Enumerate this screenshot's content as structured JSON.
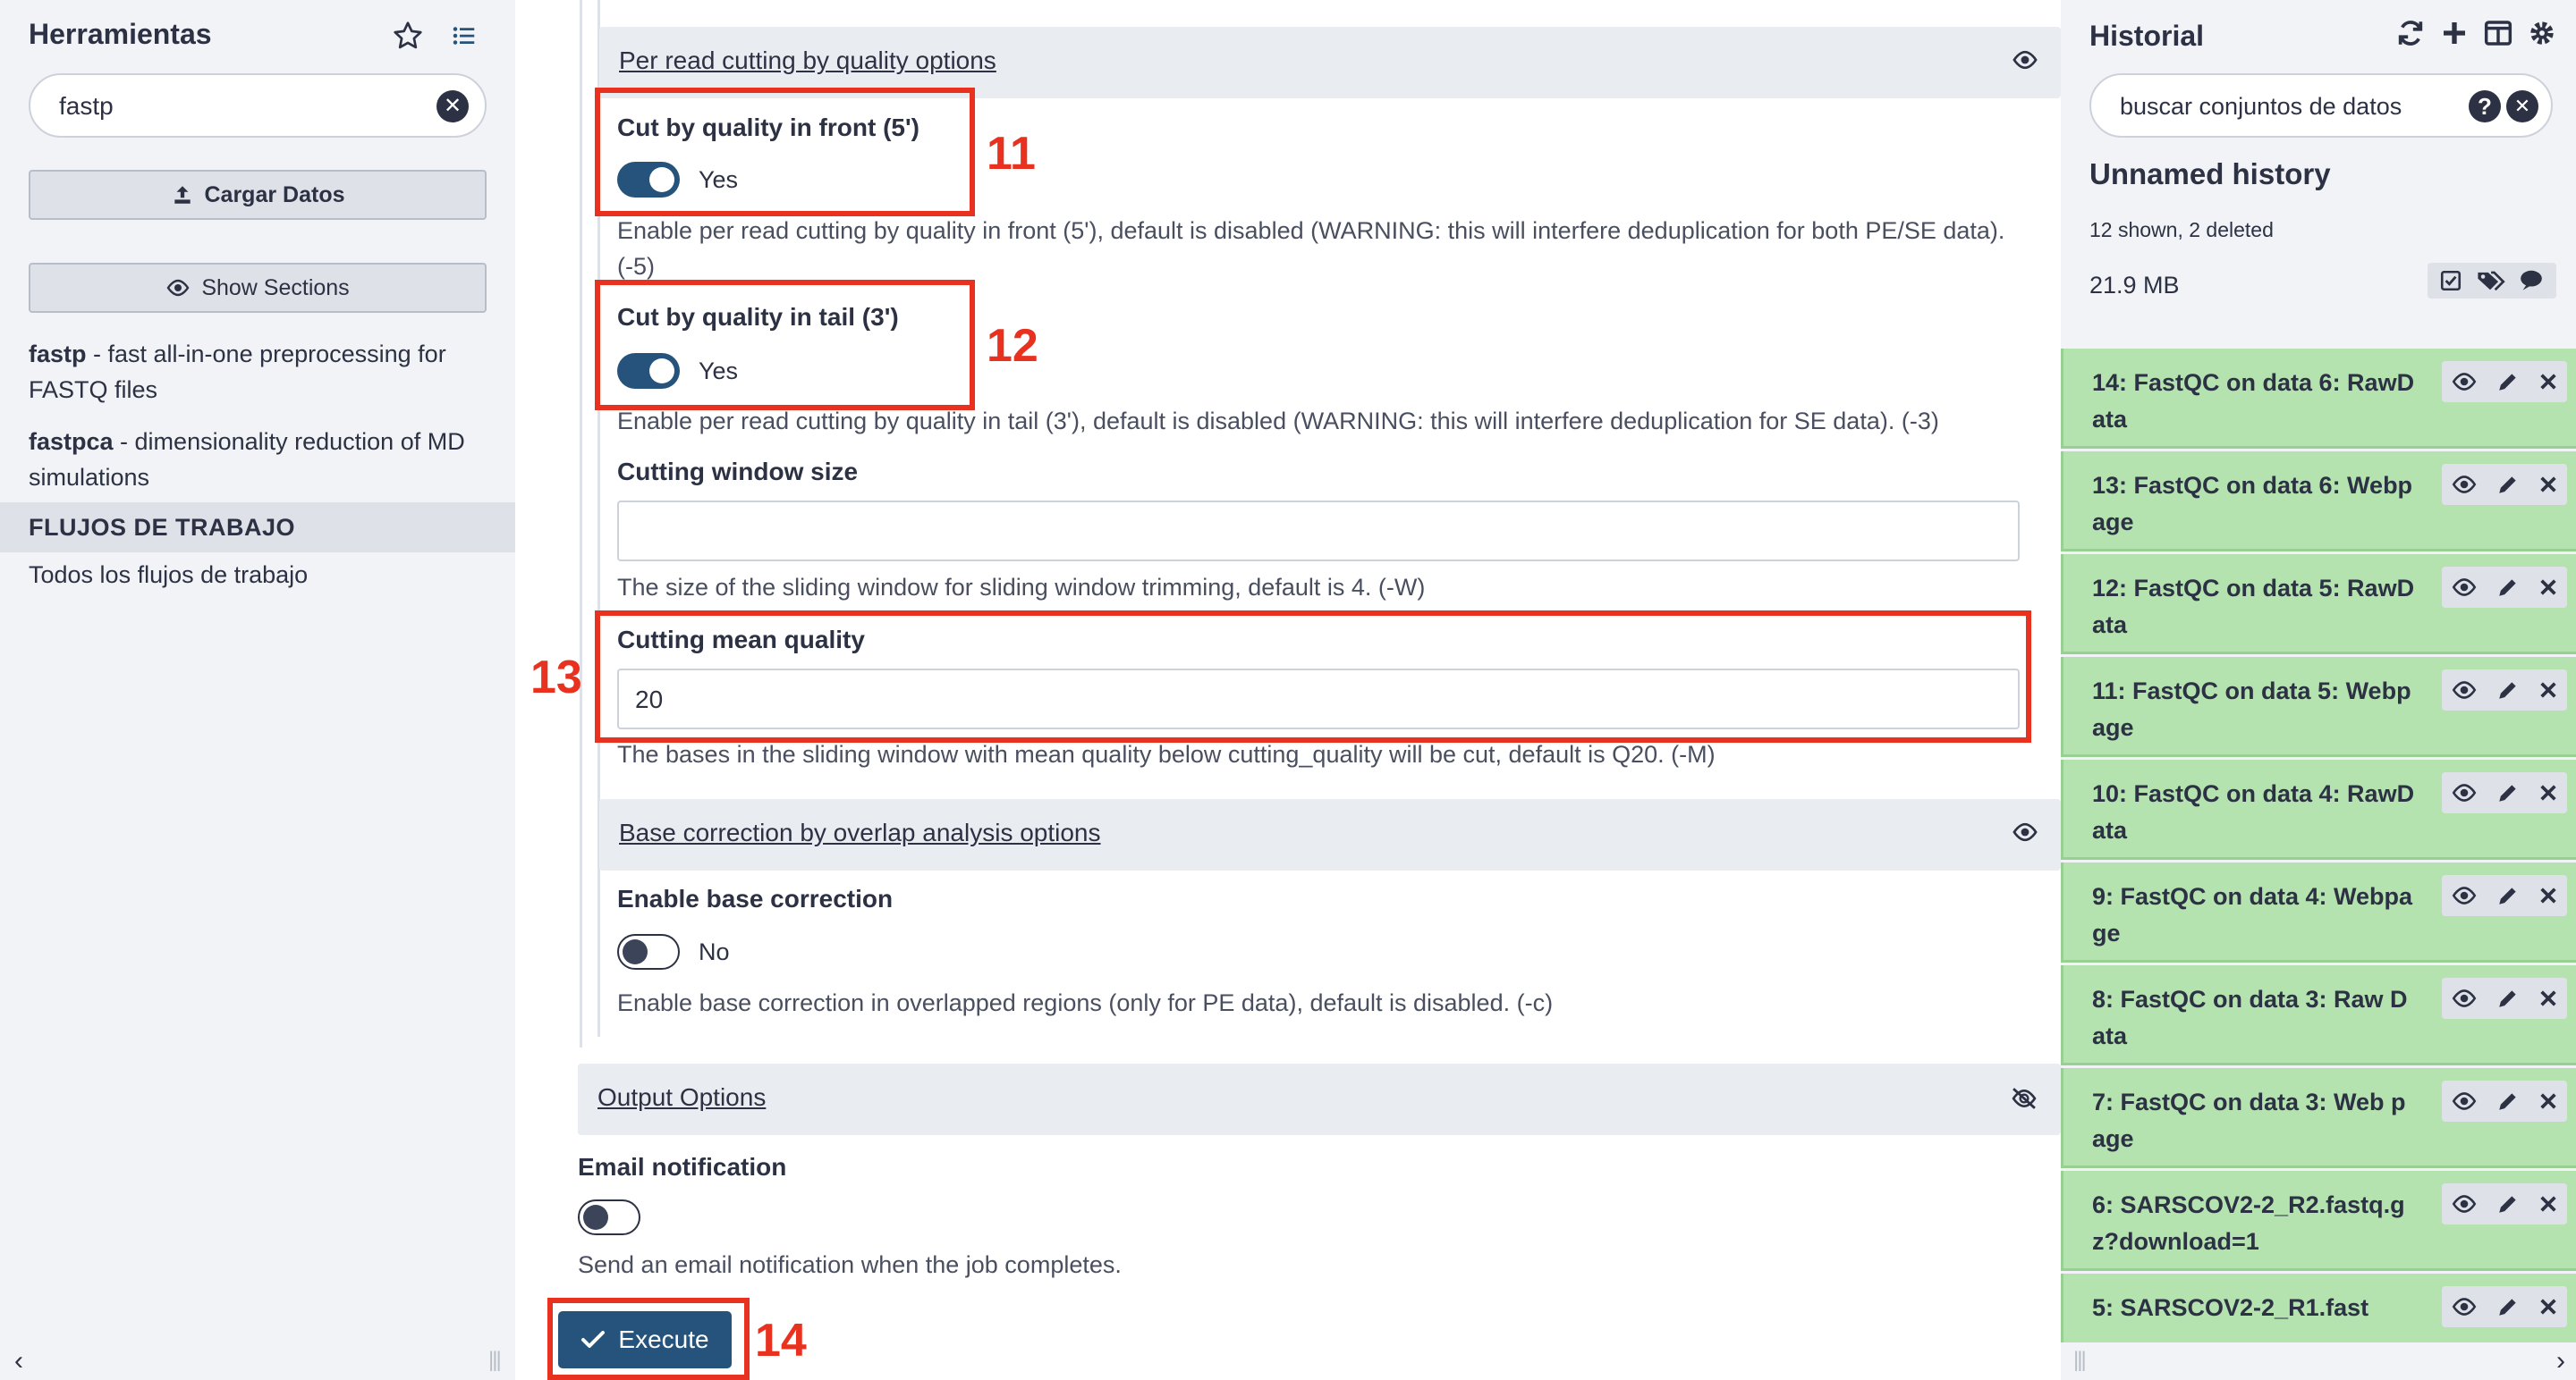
{
  "tools_panel": {
    "title": "Herramientas",
    "search_value": "fastp",
    "upload_label": "Cargar Datos",
    "show_sections_label": "Show Sections",
    "tools": [
      {
        "name": "fastp",
        "desc": " - fast all-in-one preprocessing for FASTQ files"
      },
      {
        "name": "fastpca",
        "desc": " - dimensionality reduction of MD simulations"
      }
    ],
    "workflows_header": "FLUJOS DE TRABAJO",
    "all_workflows": "Todos los flujos de trabajo"
  },
  "form": {
    "per_read_section": "Per read cutting by quality options",
    "cut_front": {
      "label": "Cut by quality in front (5')",
      "state": "Yes",
      "help": "Enable per read cutting by quality in front (5'), default is disabled (WARNING: this will interfere deduplication for both PE/SE data). (-5)"
    },
    "cut_tail": {
      "label": "Cut by quality in tail (3')",
      "state": "Yes",
      "help": "Enable per read cutting by quality in tail (3'), default is disabled (WARNING: this will interfere deduplication for SE data). (-3)"
    },
    "window_size": {
      "label": "Cutting window size",
      "value": "",
      "help": "The size of the sliding window for sliding window trimming, default is 4. (-W)"
    },
    "mean_quality": {
      "label": "Cutting mean quality",
      "value": "20",
      "help": "The bases in the sliding window with mean quality below cutting_quality will be cut, default is Q20. (-M)"
    },
    "base_correction_section": "Base correction by overlap analysis options",
    "base_correction": {
      "label": "Enable base correction",
      "state": "No",
      "help": "Enable base correction in overlapped regions (only for PE data), default is disabled. (-c)"
    },
    "output_section": "Output Options",
    "email": {
      "label": "Email notification",
      "help": "Send an email notification when the job completes."
    },
    "execute_label": "Execute"
  },
  "annotations": {
    "n11": "11",
    "n12": "12",
    "n13": "13",
    "n14": "14"
  },
  "history": {
    "title": "Historial",
    "search_placeholder": "buscar conjuntos de datos",
    "name": "Unnamed history",
    "shown": "12 shown, 2 deleted",
    "size": "21.9 MB",
    "items": [
      "14: FastQC on data 6: RawData",
      "13: FastQC on data 6: Webpage",
      "12: FastQC on data 5: RawData",
      "11: FastQC on data 5: Webpage",
      "10: FastQC on data 4: RawData",
      "9: FastQC on data 4: Webpage",
      "8: FastQC on data 3: Raw Data",
      "7: FastQC on data 3: Web page",
      "6: SARSCOV2-2_R2.fastq.gz?download=1",
      "5: SARSCOV2-2_R1.fast"
    ]
  },
  "colors": {
    "accent": "#25537b",
    "annotation": "#e8321f",
    "dataset_ok": "#b5e3b0"
  }
}
